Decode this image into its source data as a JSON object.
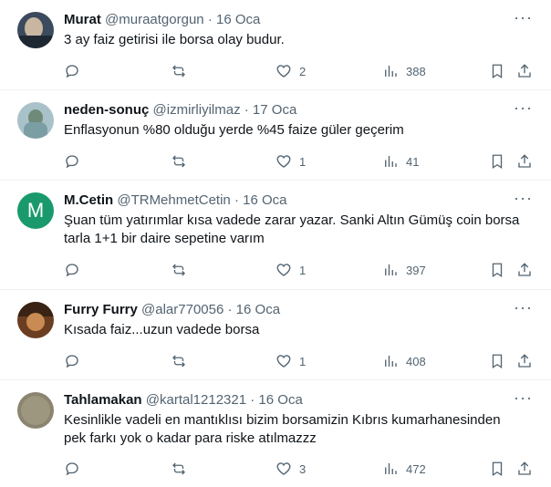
{
  "tweets": [
    {
      "name": "Murat",
      "handle": "@muraatgorgun",
      "date": "16 Oca",
      "text": "3 ay faiz getirisi ile borsa olay budur.",
      "likes": "2",
      "views": "388",
      "avatar": {
        "type": "photo",
        "bg": "#3b4a5c"
      }
    },
    {
      "name": "neden-sonuç",
      "handle": "@izmirliyilmaz",
      "date": "17 Oca",
      "text": "Enflasyonun %80 olduğu yerde %45 faize güler geçerim",
      "likes": "1",
      "views": "41",
      "avatar": {
        "type": "photo",
        "bg": "#a9c2c9"
      }
    },
    {
      "name": "M.Cetin",
      "handle": "@TRMehmetCetin",
      "date": "16 Oca",
      "text": "Şuan tüm yatırımlar kısa vadede zarar yazar. Sanki Altın Gümüş coin borsa tarla 1+1 bir daire sepetine varım",
      "likes": "1",
      "views": "397",
      "avatar": {
        "type": "letter",
        "letter": "M",
        "bg": "#1a9a6c"
      }
    },
    {
      "name": "Furry Furry",
      "handle": "@alar770056",
      "date": "16 Oca",
      "text": "Kısada faiz...uzun vadede borsa",
      "likes": "1",
      "views": "408",
      "avatar": {
        "type": "photo",
        "bg": "#6b3e22"
      }
    },
    {
      "name": "Tahlamakan",
      "handle": "@kartal1212321",
      "date": "16 Oca",
      "text": "Kesinlikle vadeli en mantıklısı bizim borsamizin Kıbrıs kumarhanesinden pek farkı yok o kadar para riske atılmazzz",
      "likes": "3",
      "views": "472",
      "avatar": {
        "type": "photo",
        "bg": "#8a8470"
      }
    }
  ],
  "separator": "·",
  "more_glyph": "···"
}
